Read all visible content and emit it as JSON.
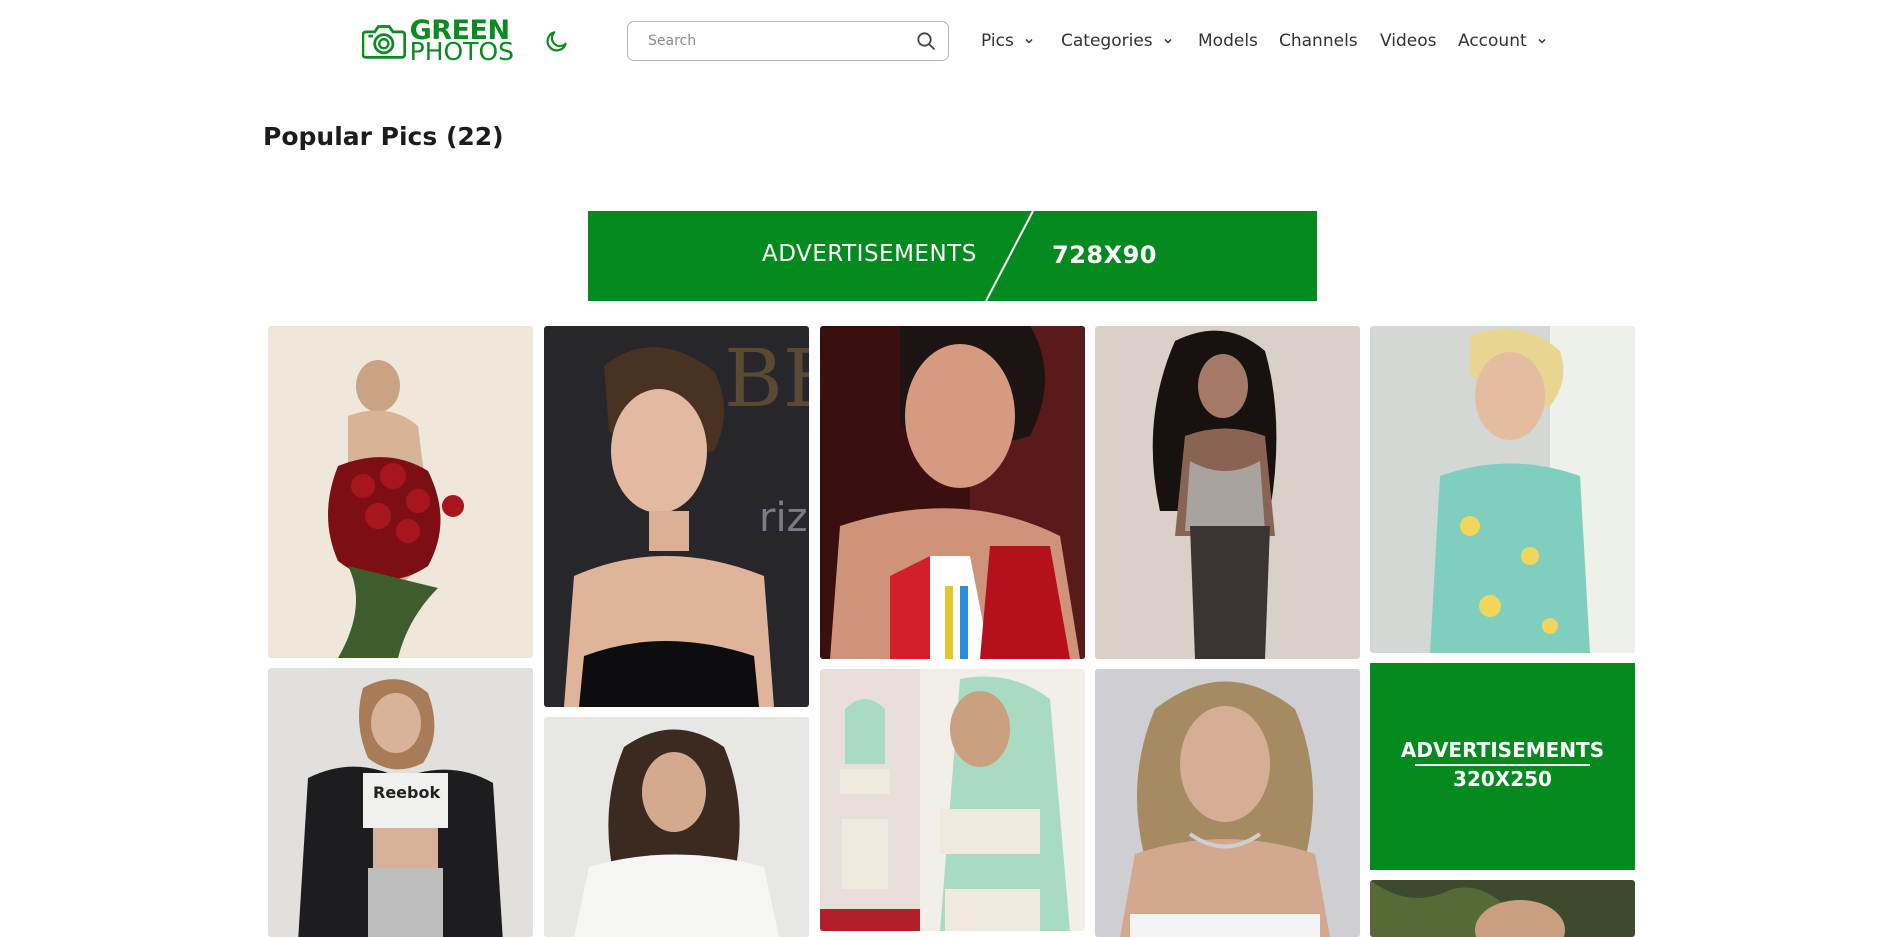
{
  "header": {
    "logo": {
      "line1": "GREEN",
      "line2": "PHOTOS",
      "icon": "camera-icon",
      "color": "#0a8a1f"
    },
    "theme_toggle_icon": "moon-icon",
    "search": {
      "placeholder": "Search",
      "value": "",
      "icon": "search-icon"
    },
    "nav": [
      {
        "label": "Pics",
        "has_dropdown": true
      },
      {
        "label": "Categories",
        "has_dropdown": true
      },
      {
        "label": "Models",
        "has_dropdown": false
      },
      {
        "label": "Channels",
        "has_dropdown": false
      },
      {
        "label": "Videos",
        "has_dropdown": false
      },
      {
        "label": "Account",
        "has_dropdown": true
      }
    ]
  },
  "main": {
    "title": "Popular Pics (22)",
    "ad_top": {
      "label": "ADVERTISEMENTS",
      "size": "728X90"
    },
    "ad_side": {
      "label": "ADVERTISEMENTS",
      "size": "320X250"
    },
    "accent_color": "#058a1f",
    "gallery_items": [
      {
        "description": "woman holding red roses"
      },
      {
        "description": "woman with updo hair, red carpet"
      },
      {
        "description": "woman selfie in striped swimsuit"
      },
      {
        "description": "woman with long black hair in sheer outfit"
      },
      {
        "description": "blonde woman in floral dress by window"
      },
      {
        "description": "woman in cropped top and black jacket"
      },
      {
        "description": "brunette woman in white crop top"
      },
      {
        "description": "woman with mint green hair, white outfit"
      },
      {
        "description": "blonde woman portrait with necklace"
      },
      {
        "description": "woman partially visible with foliage"
      }
    ]
  }
}
